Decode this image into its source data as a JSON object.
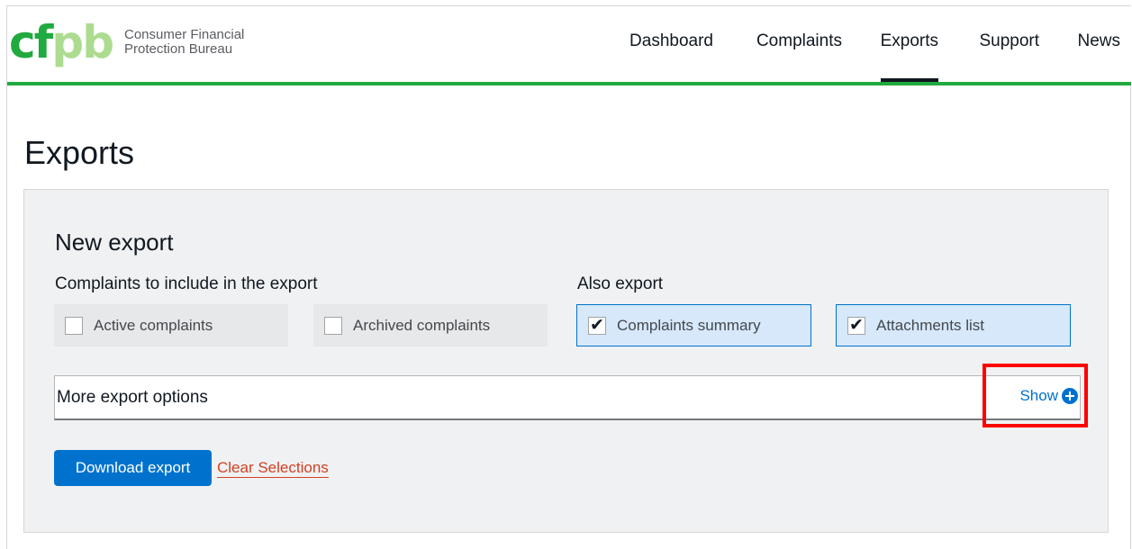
{
  "brand": {
    "logo_mark_dark": "cf",
    "logo_mark_light": "pb",
    "name_line1": "Consumer Financial",
    "name_line2": "Protection Bureau",
    "primary_green": "#20aa3f",
    "accent_blue": "#0072ce",
    "alert_red": "#d14124"
  },
  "nav": {
    "items": [
      {
        "label": "Dashboard",
        "active": false
      },
      {
        "label": "Complaints",
        "active": false
      },
      {
        "label": "Exports",
        "active": true
      },
      {
        "label": "Support",
        "active": false
      },
      {
        "label": "News",
        "active": false
      }
    ]
  },
  "page": {
    "title": "Exports"
  },
  "panel": {
    "title": "New export",
    "include_group": {
      "label": "Complaints to include in the export",
      "options": [
        {
          "label": "Active complaints",
          "checked": false
        },
        {
          "label": "Archived complaints",
          "checked": false
        }
      ]
    },
    "also_group": {
      "label": "Also export",
      "options": [
        {
          "label": "Complaints summary",
          "checked": true
        },
        {
          "label": "Attachments list",
          "checked": true
        }
      ]
    },
    "more_options": {
      "label": "More export options",
      "toggle_label": "Show",
      "toggle_icon": "plus-circle-icon"
    },
    "actions": {
      "download_label": "Download export",
      "clear_label": "Clear Selections"
    }
  },
  "checkmark_glyph": "✔"
}
